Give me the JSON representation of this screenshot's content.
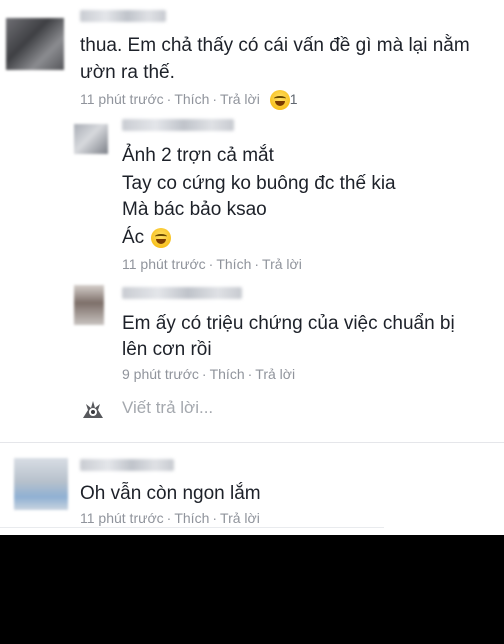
{
  "comment1": {
    "line1": "thua. Em chả thấy có cái vấn đề gì mà lại nằm",
    "line2": "ườn ra thế.",
    "time": "11 phút trước",
    "like": "Thích",
    "reply": "Trả lời",
    "reaction_count": "1"
  },
  "reply1": {
    "line1": "Ảnh 2 trợn cả mắt",
    "line2": "Tay co cứng ko buông đc thế kia",
    "line3": "Mà bác bảo ksao",
    "line4": "Ác",
    "time": "11 phút trước",
    "like": "Thích",
    "reply": "Trả lời"
  },
  "reply2": {
    "line1": "Em ấy có triệu chứng của việc chuẩn bị",
    "line2": "lên cơn rồi",
    "time": "9 phút trước",
    "like": "Thích",
    "reply": "Trả lời"
  },
  "reply_box": {
    "placeholder": "Viết trả lời..."
  },
  "comment2": {
    "line1": "Oh vẫn còn ngon lắm",
    "time": "11 phút trước",
    "like": "Thích",
    "reply": "Trả lời"
  },
  "icons": {
    "reaction": "laughing-emoji-icon",
    "reply1_emoji": "tears-of-joy-emoji-icon",
    "reply_avatar": "user-avatar-icon"
  },
  "colors": {
    "text": "#1d2129",
    "meta": "#90949c",
    "background": "#ffffff"
  }
}
